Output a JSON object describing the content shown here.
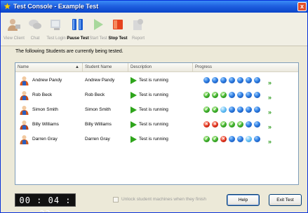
{
  "window": {
    "title": "Test Console - Example Test",
    "close_glyph": "x"
  },
  "toolbar": {
    "buttons": [
      {
        "label": "View Client",
        "icon": "view-client-icon",
        "enabled": false
      },
      {
        "label": "Chat",
        "icon": "chat-icon",
        "enabled": false
      },
      {
        "label": "Test Login",
        "icon": "test-login-icon",
        "enabled": false
      },
      {
        "label": "Pause Test",
        "icon": "pause-test-icon",
        "enabled": true
      },
      {
        "label": "Start Test",
        "icon": "start-test-icon",
        "enabled": false
      },
      {
        "label": "Stop Test",
        "icon": "stop-test-icon",
        "enabled": true
      },
      {
        "label": "Report",
        "icon": "report-icon",
        "enabled": false
      }
    ]
  },
  "message": "The following Students are currently being tested.",
  "table": {
    "columns": [
      "Name",
      "Student Name",
      "Description",
      "Progress"
    ],
    "rows": [
      {
        "name": "Andrew Pandy",
        "student_name": "Andrew Pandy",
        "description": "Test is running",
        "progress": [
          "blue",
          "blue",
          "blue",
          "blue",
          "blue",
          "blue",
          "blue"
        ]
      },
      {
        "name": "Rob Beck",
        "student_name": "Rob Beck",
        "description": "Test is running",
        "progress": [
          "green",
          "green",
          "green",
          "blue",
          "blue",
          "blue",
          "blue"
        ]
      },
      {
        "name": "Simon Smith",
        "student_name": "Simon Smith",
        "description": "Test is running",
        "progress": [
          "green",
          "green",
          "lightblue",
          "blue",
          "blue",
          "blue",
          "blue"
        ]
      },
      {
        "name": "Billy Williams",
        "student_name": "Billy Williams",
        "description": "Test is running",
        "progress": [
          "red",
          "red",
          "green",
          "green",
          "green",
          "blue",
          "blue"
        ]
      },
      {
        "name": "Darren Gray",
        "student_name": "Darren Gray",
        "description": "Test is running",
        "progress": [
          "green",
          "green",
          "red",
          "blue",
          "blue",
          "lightblue",
          "blue"
        ]
      }
    ]
  },
  "status": {
    "timer": "00 : 04 : 23",
    "unlock_label": "Unlock student machines when they finish",
    "unlock_checked": false
  },
  "buttons": {
    "help": "Help",
    "exit": "Exit Test"
  },
  "colors": {
    "titlebar": "#1f5fe0",
    "run_icon": "#2fa51c",
    "chevron": "#2a9a1c"
  }
}
